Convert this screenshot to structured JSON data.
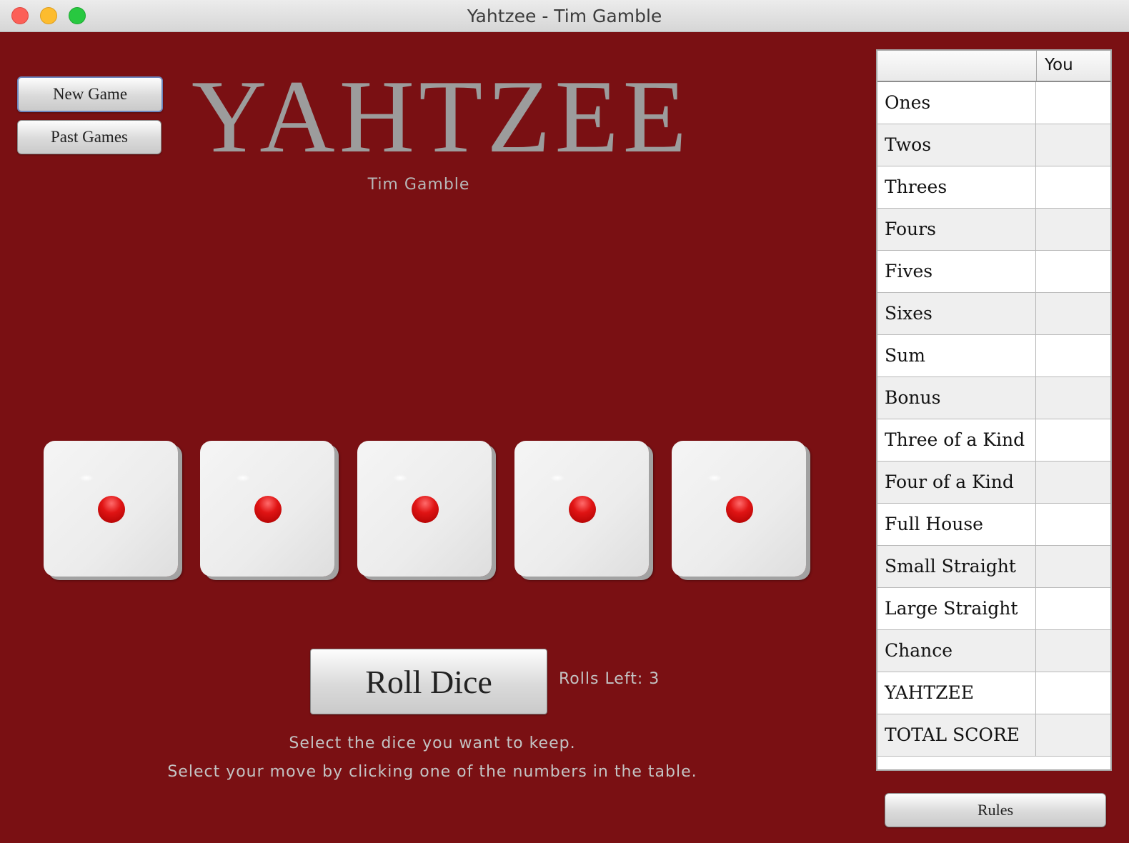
{
  "window": {
    "title": "Yahtzee - Tim Gamble"
  },
  "toolbar": {
    "new_game": "New Game",
    "past_games": "Past Games"
  },
  "header": {
    "logo": "YAHTZEE",
    "author": "Tim Gamble"
  },
  "dice": [
    {
      "value": 1,
      "color": "#e01414"
    },
    {
      "value": 1,
      "color": "#e01414"
    },
    {
      "value": 1,
      "color": "#e01414"
    },
    {
      "value": 1,
      "color": "#e01414"
    },
    {
      "value": 1,
      "color": "#e01414"
    }
  ],
  "roll": {
    "label": "Roll Dice",
    "rolls_left": "Rolls Left: 3"
  },
  "instructions": {
    "line1": "Select the dice you want to keep.",
    "line2": "Select your move by clicking one of the numbers in the table."
  },
  "scorecard": {
    "columns": [
      "",
      "You"
    ],
    "rows": [
      {
        "label": "Ones",
        "value": ""
      },
      {
        "label": "Twos",
        "value": ""
      },
      {
        "label": "Threes",
        "value": ""
      },
      {
        "label": "Fours",
        "value": ""
      },
      {
        "label": "Fives",
        "value": ""
      },
      {
        "label": "Sixes",
        "value": ""
      },
      {
        "label": "Sum",
        "value": ""
      },
      {
        "label": "Bonus",
        "value": ""
      },
      {
        "label": "Three of a Kind",
        "value": ""
      },
      {
        "label": "Four of a Kind",
        "value": ""
      },
      {
        "label": "Full House",
        "value": ""
      },
      {
        "label": "Small Straight",
        "value": ""
      },
      {
        "label": "Large Straight",
        "value": ""
      },
      {
        "label": "Chance",
        "value": ""
      },
      {
        "label": "YAHTZEE",
        "value": ""
      },
      {
        "label": "TOTAL SCORE",
        "value": ""
      }
    ],
    "rules_label": "Rules"
  },
  "colors": {
    "background": "#7a1013",
    "text_muted": "#c4c4c4",
    "logo": "#9c9c9c"
  }
}
